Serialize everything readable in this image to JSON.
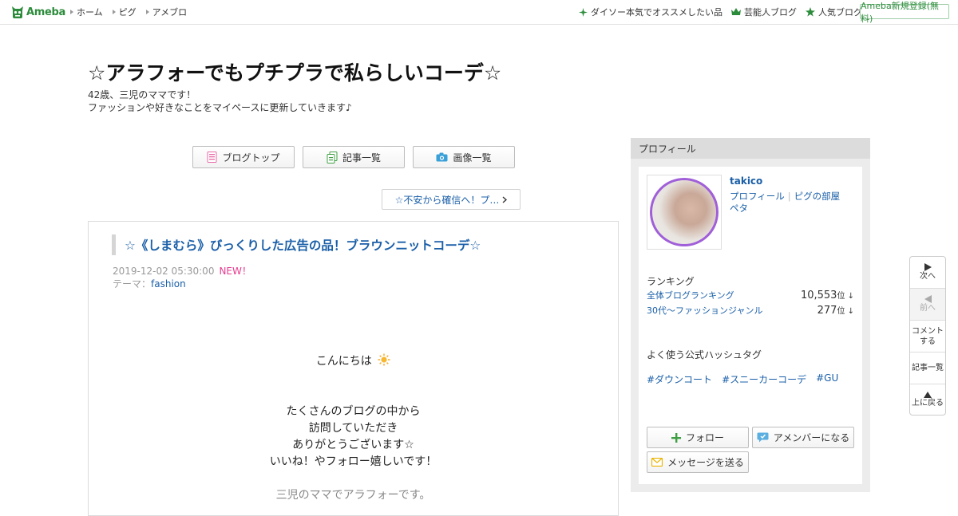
{
  "header": {
    "logo": "Ameba",
    "gnav": [
      "ホーム",
      "ピグ",
      "アメブロ"
    ],
    "rnav": [
      {
        "label": "ダイソー本気でオススメしたい品",
        "icon": "sparkle-icon"
      },
      {
        "label": "芸能人ブログ",
        "icon": "crown-icon"
      },
      {
        "label": "人気ブログ",
        "icon": "star-icon"
      }
    ],
    "signup": "Ameba新規登録(無料)"
  },
  "blog": {
    "title": "☆アラフォーでもプチプラで私らしいコーデ☆",
    "desc1": "42歳、三児のママです！",
    "desc2": "ファッションや好きなことをマイペースに更新していきます♪"
  },
  "nav": {
    "top": "ブログトップ",
    "list": "記事一覧",
    "images": "画像一覧",
    "prev": "☆不安から確信へ！プ…"
  },
  "entry": {
    "title": "☆《しまむら》びっくりした広告の品！ブラウンニットコーデ☆",
    "date": "2019-12-02 05:30:00",
    "new": "NEW！",
    "theme_label": "テーマ：",
    "theme": "fashion",
    "body": [
      "こんにちは",
      "たくさんのブログの中から",
      "訪問していただき",
      "ありがとうございます☆",
      "いいね！やフォロー嬉しいです！",
      "三児のママでアラフォーです。"
    ]
  },
  "profile": {
    "heading": "プロフィール",
    "name": "takico",
    "link_profile": "プロフィール",
    "link_room": "ピグの部屋",
    "link_peta": "ペタ",
    "ranking_heading": "ランキング",
    "ranks": [
      {
        "label": "全体ブログランキング",
        "value": "10,553",
        "unit": "位 ↓"
      },
      {
        "label": "30代〜ファッションジャンル",
        "value": "277",
        "unit": "位 ↓"
      }
    ],
    "hashtag_heading": "よく使う公式ハッシュタグ",
    "hashtags": [
      "#ダウンコート",
      "#スニーカーコーデ",
      "#GU"
    ],
    "follow": "フォロー",
    "amember": "アメンバーになる",
    "message": "メッセージを送る"
  },
  "floatnav": {
    "next": "次へ",
    "prev": "前へ",
    "comment1": "コメント",
    "comment2": "する",
    "list": "記事一覧",
    "top": "上に戻る"
  },
  "colors": {
    "brand": "#2d8c3c",
    "link": "#1a5fa8",
    "new": "#e83b8f",
    "avatar_ring": "#a05fd8"
  }
}
